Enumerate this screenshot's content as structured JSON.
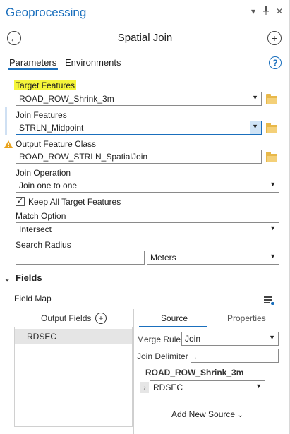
{
  "titlebar": {
    "title": "Geoprocessing",
    "menu_icon": "chevron-down-icon",
    "pin_icon": "pin-icon",
    "close_icon": "close-icon",
    "menu_glyph": "▾",
    "pin_glyph": "📌",
    "close_glyph": "✕"
  },
  "header": {
    "tool_title": "Spatial Join",
    "back_glyph": "←",
    "add_glyph": "+"
  },
  "tabs": {
    "parameters": "Parameters",
    "environments": "Environments",
    "help_glyph": "?"
  },
  "params": {
    "target_features_label": "Target Features",
    "target_features_value": "ROAD_ROW_Shrink_3m",
    "join_features_label": "Join Features",
    "join_features_value": "STRLN_Midpoint",
    "output_class_label": "Output Feature Class",
    "output_class_value": "ROAD_ROW_STRLN_SpatialJoin",
    "join_operation_label": "Join Operation",
    "join_operation_value": "Join one to one",
    "keep_all_label": "Keep All Target Features",
    "keep_all_checked": true,
    "match_option_label": "Match Option",
    "match_option_value": "Intersect",
    "search_radius_label": "Search Radius",
    "search_radius_value": "",
    "search_radius_unit": "Meters"
  },
  "fields": {
    "section_title": "Fields",
    "field_map_label": "Field Map",
    "output_fields_header": "Output Fields",
    "output_fields": [
      "RDSEC"
    ],
    "source_tab": "Source",
    "properties_tab": "Properties",
    "merge_rule_label": "Merge Rule",
    "merge_rule_value": "Join",
    "join_delimiter_label": "Join Delimiter",
    "join_delimiter_value": ",",
    "source_layer": "ROAD_ROW_Shrink_3m",
    "source_field": "RDSEC",
    "add_new_source": "Add New Source"
  },
  "colors": {
    "accent": "#1a6fbd",
    "highlight": "#f5f53a",
    "folder": "#e8b84a",
    "warning": "#e9a21a"
  }
}
